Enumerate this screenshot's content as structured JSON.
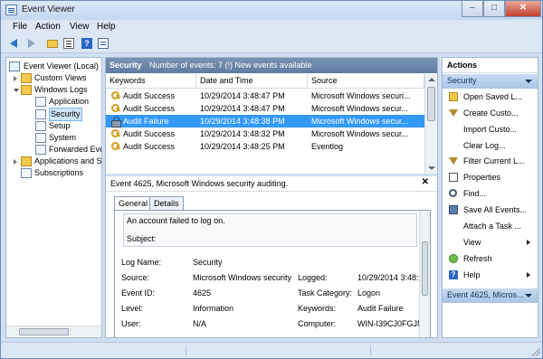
{
  "window": {
    "title": "Event Viewer",
    "minimize": "–",
    "maximize": "□",
    "close": "✕"
  },
  "menu": [
    "File",
    "Action",
    "View",
    "Help"
  ],
  "toolbar": {
    "icons": [
      "back-icon",
      "forward-icon",
      "up-folder-icon",
      "properties-icon",
      "help-icon",
      "list-icon"
    ]
  },
  "tree": {
    "root": "Event Viewer (Local)",
    "custom_views": "Custom Views",
    "windows_logs": "Windows Logs",
    "application": "Application",
    "security": "Security",
    "setup": "Setup",
    "system": "System",
    "forwarded": "Forwarded Eve",
    "apps_services": "Applications and S",
    "subscriptions": "Subscriptions"
  },
  "middle": {
    "log_name": "Security",
    "count_text": "Number of events: 7 (!) New events available",
    "columns": [
      "Keywords",
      "Date and Time",
      "Source"
    ],
    "rows": [
      {
        "keyword": "Audit Success",
        "datetime": "10/29/2014 3:48:47 PM",
        "source": "Microsoft Windows securi...",
        "icon": "key-icon"
      },
      {
        "keyword": "Audit Success",
        "datetime": "10/29/2014 3:48:47 PM",
        "source": "Microsoft Windows secur...",
        "icon": "key-icon"
      },
      {
        "keyword": "Audit Failure",
        "datetime": "10/29/2014 3:48:38 PM",
        "source": "Microsoft Windows secur...",
        "icon": "lock-icon"
      },
      {
        "keyword": "Audit Success",
        "datetime": "10/29/2014 3:48:32 PM",
        "source": "Microsoft Windows secur...",
        "icon": "key-icon"
      },
      {
        "keyword": "Audit Success",
        "datetime": "10/29/2014 3:48:25 PM",
        "source": "Eventlog",
        "icon": "key-icon"
      }
    ]
  },
  "detail": {
    "title": "Event 4625, Microsoft Windows security auditing.",
    "close": "✕",
    "tabs": [
      "General",
      "Details"
    ],
    "message_line1": "An account failed to log on.",
    "message_line2": "Subject:",
    "labels": {
      "log_name": "Log Name:",
      "source": "Source:",
      "event_id": "Event ID:",
      "level": "Level:",
      "user": "User:",
      "logged": "Logged:",
      "task_category": "Task Category:",
      "keywords": "Keywords:",
      "computer": "Computer:"
    },
    "values": {
      "log_name": "Security",
      "source": "Microsoft Windows security",
      "event_id": "4625",
      "level": "Information",
      "user": "N/A",
      "logged": "10/29/2014 3:48:3",
      "task_category": "Logon",
      "keywords": "Audit Failure",
      "computer": "WIN-I39CJ0FGJN"
    }
  },
  "actions": {
    "title": "Actions",
    "section1": "Security",
    "items": [
      {
        "label": "Open Saved L...",
        "icon": "open-folder-icon"
      },
      {
        "label": "Create Custo...",
        "icon": "filter-icon"
      },
      {
        "label": "Import Custo...",
        "icon": ""
      },
      {
        "label": "Clear Log...",
        "icon": ""
      },
      {
        "label": "Filter Current L...",
        "icon": "filter-icon"
      },
      {
        "label": "Properties",
        "icon": "properties-icon"
      },
      {
        "label": "Find...",
        "icon": "find-icon"
      },
      {
        "label": "Save All Events...",
        "icon": "save-icon"
      },
      {
        "label": "Attach a Task ...",
        "icon": ""
      },
      {
        "label": "View",
        "icon": ""
      },
      {
        "label": "Refresh",
        "icon": "refresh-icon"
      },
      {
        "label": "Help",
        "icon": "help-icon"
      }
    ],
    "section2": "Event 4625, Micros..."
  }
}
